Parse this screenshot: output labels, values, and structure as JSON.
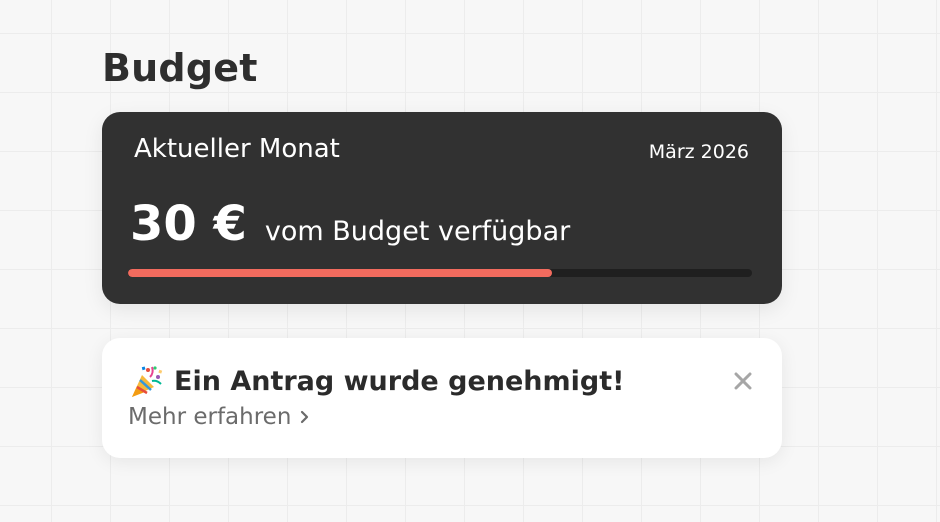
{
  "page": {
    "title": "Budget"
  },
  "budget_card": {
    "month_label": "Aktueller Monat",
    "month_value": "März 2026",
    "amount": "30 €",
    "amount_suffix": "vom Budget verfügbar",
    "progress_fraction": 0.68,
    "colors": {
      "background": "#313131",
      "progress_fill": "#f26b5e",
      "progress_track": "#1f1f1f"
    }
  },
  "notification": {
    "icon": "party-popper-icon",
    "text": "Ein Antrag wurde genehmigt!",
    "link_label": "Mehr erfahren",
    "link_icon": "chevron-right-icon",
    "close_icon": "close-icon"
  }
}
